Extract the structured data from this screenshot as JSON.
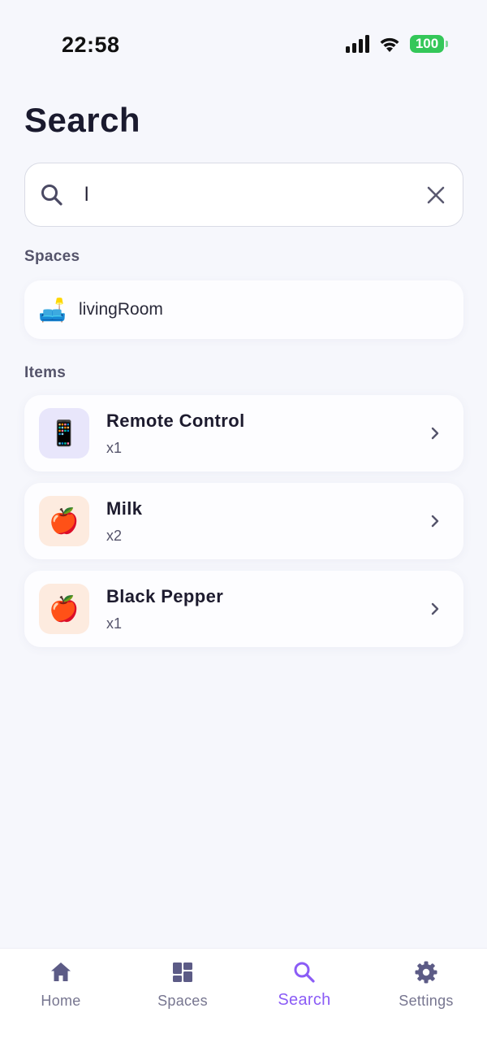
{
  "status_bar": {
    "time": "22:58",
    "battery": "100",
    "battery_color": "#34c759"
  },
  "page": {
    "title": "Search"
  },
  "search": {
    "value": "l",
    "placeholder": "",
    "search_icon": "search-icon",
    "clear_icon": "close-icon"
  },
  "spaces_section": {
    "label": "Spaces",
    "items": [
      {
        "emoji": "🛋️",
        "name": "livingRoom"
      }
    ]
  },
  "items_section": {
    "label": "Items",
    "items": [
      {
        "emoji": "📱",
        "name": "Remote Control",
        "qty": "x1",
        "thumb_color": "#e8e6fb"
      },
      {
        "emoji": "🍎",
        "name": "Milk",
        "qty": "x2",
        "thumb_color": "#fdebdf"
      },
      {
        "emoji": "🍎",
        "name": "Black Pepper",
        "qty": "x1",
        "thumb_color": "#fdebdf"
      }
    ]
  },
  "tab_bar": {
    "accent": "#8b5cf6",
    "tabs": [
      {
        "label": "Home",
        "icon": "home-icon",
        "active": false
      },
      {
        "label": "Spaces",
        "icon": "grid-icon",
        "active": false
      },
      {
        "label": "Search",
        "icon": "search-icon",
        "active": true
      },
      {
        "label": "Settings",
        "icon": "gear-icon",
        "active": false
      }
    ]
  }
}
